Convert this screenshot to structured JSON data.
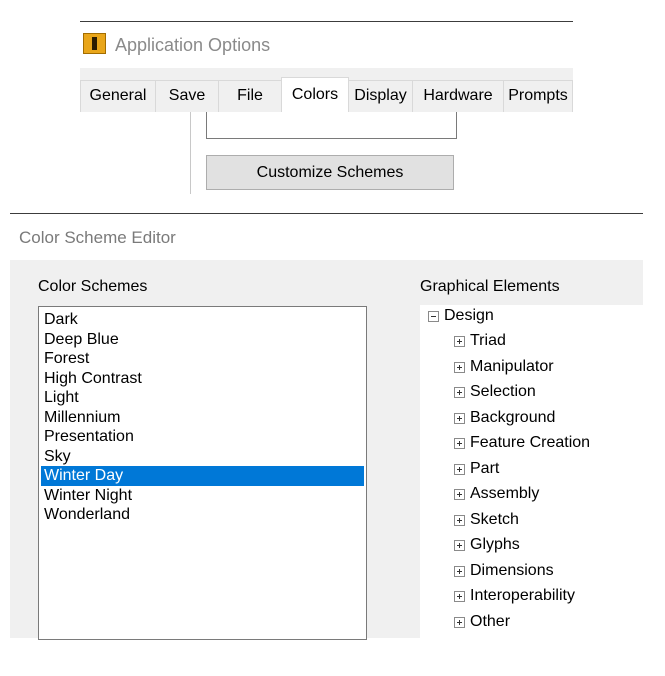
{
  "app_options": {
    "title": "Application Options",
    "icon": "inventor-app-icon",
    "tabs": [
      {
        "label": "General",
        "active": false
      },
      {
        "label": "Save",
        "active": false
      },
      {
        "label": "File",
        "active": false
      },
      {
        "label": "Colors",
        "active": true
      },
      {
        "label": "Display",
        "active": false
      },
      {
        "label": "Hardware",
        "active": false
      },
      {
        "label": "Prompts",
        "active": false
      }
    ],
    "customize_button": "Customize Schemes"
  },
  "color_scheme_editor": {
    "title": "Color Scheme Editor",
    "schemes_label": "Color Schemes",
    "schemes": [
      "Dark",
      "Deep Blue",
      "Forest",
      "High Contrast",
      "Light",
      "Millennium",
      "Presentation",
      "Sky",
      "Winter Day",
      "Winter Night",
      "Wonderland"
    ],
    "selected_scheme": "Winter Day",
    "selection_color": "#0078d7",
    "elements_label": "Graphical Elements",
    "tree_root": {
      "label": "Design",
      "expanded": true
    },
    "tree_children": [
      "Triad",
      "Manipulator",
      "Selection",
      "Background",
      "Feature Creation",
      "Part",
      "Assembly",
      "Sketch",
      "Glyphs",
      "Dimensions",
      "Interoperability",
      "Other"
    ]
  }
}
